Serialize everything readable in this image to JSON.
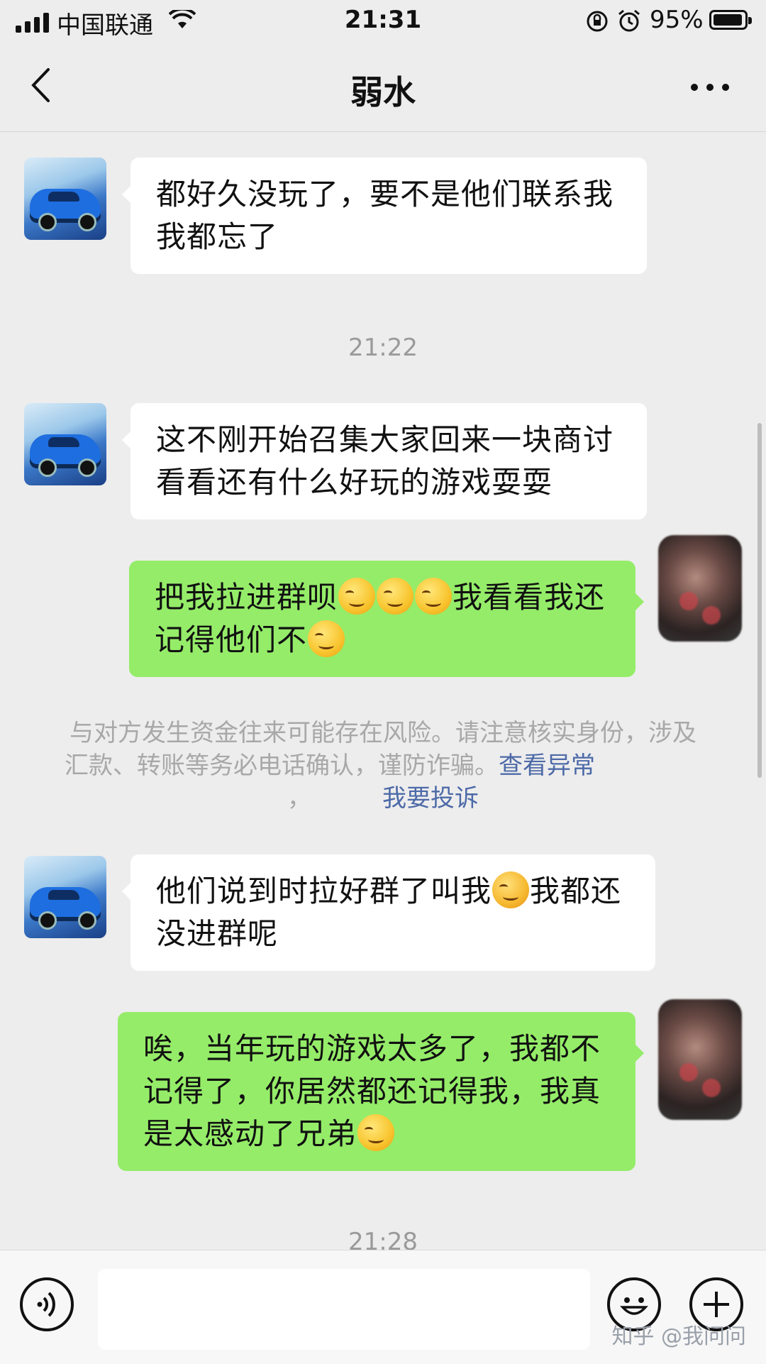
{
  "status_bar": {
    "carrier": "中国联通",
    "time": "21:31",
    "battery_percent": "95%",
    "battery_level": 0.95,
    "icons": [
      "signal-icon",
      "wifi-icon",
      "rotation-lock-icon",
      "alarm-icon",
      "battery-icon"
    ]
  },
  "header": {
    "title": "弱水",
    "back_icon": "chevron-left-icon",
    "more_icon": "more-dots-icon"
  },
  "messages": [
    {
      "side": "in",
      "text": "都好久没玩了，要不是他们联系我我都忘了"
    },
    {
      "type": "time",
      "text": "21:22"
    },
    {
      "side": "in",
      "text": "这不刚开始召集大家回来一块商讨看看还有什么好玩的游戏耍耍"
    },
    {
      "side": "out",
      "text_a": "把我拉进群呗",
      "text_b": "我看看我还记得他们不",
      "emoji": "smirk-emoji"
    },
    {
      "type": "notice",
      "text": "与对方发生资金往来可能存在风险。请注意核实身份，涉及汇款、转账等务必电话确认，谨防诈骗。",
      "link_check": "查看异常",
      "separator": "，",
      "link_report": "我要投诉"
    },
    {
      "side": "in",
      "text_a": "他们说到时拉好群了叫我",
      "text_b": "我都还没进群呢",
      "emoji": "crying-laughing-emoji"
    },
    {
      "side": "out",
      "text": "唉，当年玩的游戏太多了，我都不记得了，你居然都还记得我，我真是太感动了兄弟",
      "emoji": "smirk-emoji"
    },
    {
      "type": "time",
      "text": "21:28"
    }
  ],
  "input_bar": {
    "voice_icon": "voice-icon",
    "input_value": "",
    "emoji_icon": "emoji-icon",
    "plus_icon": "plus-icon"
  },
  "watermark": "知乎 @我问问"
}
